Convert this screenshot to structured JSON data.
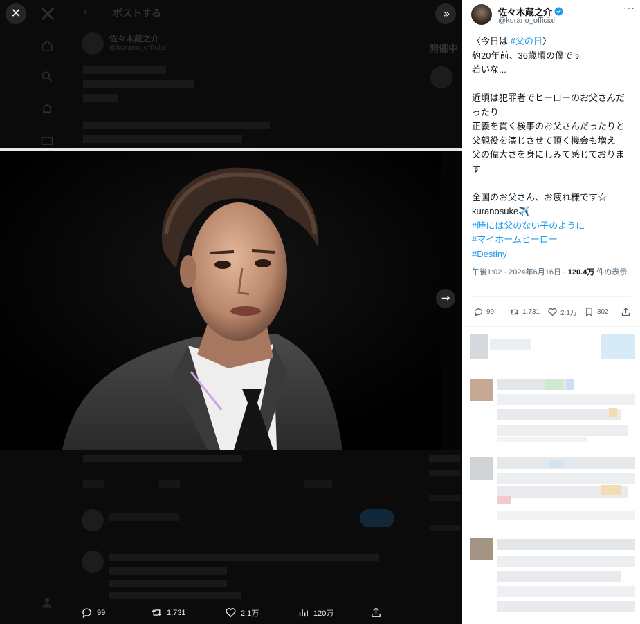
{
  "viewer": {
    "close_glyph": "✕",
    "toggle_glyph": "»",
    "next_glyph": "→",
    "photo_alt": "Man with tousled hair in a dark suit, white shirt and dark tie",
    "background_page": {
      "header_title": "ポストする",
      "author_name": "佐々木蔵之介",
      "author_handle": "@kurano_official",
      "side_heading": "開催中"
    },
    "bottom_actions": [
      {
        "name": "reply",
        "icon": "reply-icon",
        "count": "99"
      },
      {
        "name": "retweet",
        "icon": "retweet-icon",
        "count": "1,731"
      },
      {
        "name": "like",
        "icon": "heart-icon",
        "count": "2.1万"
      },
      {
        "name": "views",
        "icon": "views-icon",
        "count": "120万"
      },
      {
        "name": "share",
        "icon": "share-icon",
        "count": ""
      }
    ]
  },
  "panel": {
    "author": {
      "name": "佐々木蔵之介",
      "handle": "@kurano_official",
      "verified": true,
      "verified_color": "#1d9bf0"
    },
    "more_glyph": "···",
    "body": {
      "line1_prefix": "〈今日は ",
      "line1_tag": "#父の日",
      "line1_suffix": "〉",
      "line2": "約20年前、36歳頃の僕です",
      "line3": "若いな...",
      "line4": "近頃は犯罪者でヒーローのお父さんだ",
      "line5": "ったり",
      "line6": "正義を貫く検事のお父さんだったりと",
      "line7": "父親役を演じさせて頂く機会も増え",
      "line8": "父の偉大さを身にしみて感じておりま",
      "line9": "す",
      "line10": "全国のお父さん、お疲れ様です☆",
      "line11": "kuranosuke✈️",
      "tag1": "#時には父のない子のように",
      "tag2": "#マイホームヒーロー",
      "tag3": "#Destiny"
    },
    "meta": {
      "time": "午後1:02 · 2024年6月16日 · ",
      "views_value": "120.4万",
      "views_label": " 件の表示"
    },
    "actions": [
      {
        "name": "reply",
        "icon": "reply-icon",
        "count": "99"
      },
      {
        "name": "retweet",
        "icon": "retweet-icon",
        "count": "1,731"
      },
      {
        "name": "like",
        "icon": "heart-icon",
        "count": "2.1万"
      },
      {
        "name": "bookmark",
        "icon": "bookmark-icon",
        "count": "302"
      },
      {
        "name": "share",
        "icon": "share-icon",
        "count": ""
      }
    ]
  },
  "colors": {
    "accent": "#1d9bf0",
    "viewer_bg": "#0b0b0b",
    "panel_bg": "#ffffff",
    "muted_text": "#536471"
  }
}
